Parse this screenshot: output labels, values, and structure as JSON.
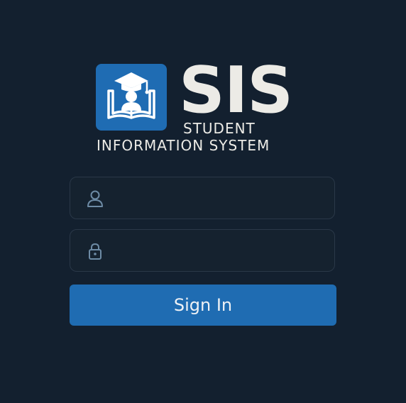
{
  "brand": {
    "title": "SIS",
    "subtitle_line1": "STUDENT",
    "subtitle_line2": "INFORMATION SYSTEM",
    "logo_icon": "graduate-book-icon",
    "logo_color": "#1f6cb3"
  },
  "login": {
    "username": {
      "value": "",
      "placeholder": "",
      "icon": "user-icon"
    },
    "password": {
      "value": "",
      "placeholder": "",
      "icon": "lock-icon"
    },
    "submit_label": "Sign In"
  },
  "colors": {
    "background": "#13202f",
    "accent": "#1f6cb2",
    "field_border": "#2a3848",
    "icon": "#6d8ba5"
  }
}
